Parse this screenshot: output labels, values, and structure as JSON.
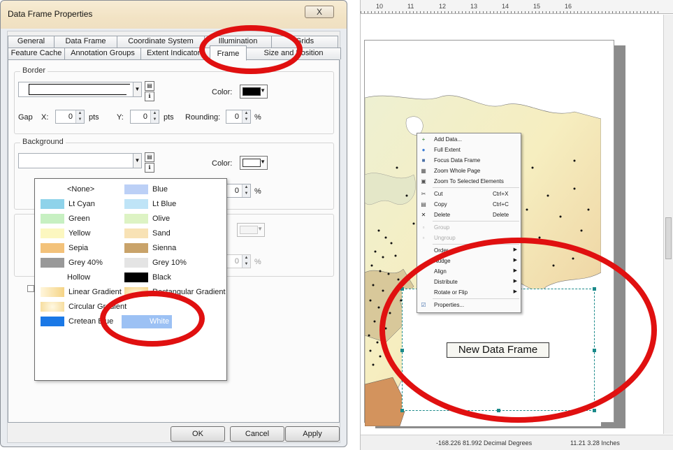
{
  "dialog": {
    "title": "Data Frame Properties",
    "close_glyph": "X",
    "tabs_row1": [
      "General",
      "Data Frame",
      "Coordinate System",
      "Illumination",
      "Grids"
    ],
    "tabs_row2": [
      "Feature Cache",
      "Annotation Groups",
      "Extent Indicators",
      "Frame",
      "Size and Position"
    ],
    "active_tab": "Frame",
    "border": {
      "group_label": "Border",
      "color_label": "Color:",
      "color": "#000000",
      "gap_label": "Gap",
      "x_label": "X:",
      "x_value": "0",
      "x_unit": "pts",
      "y_label": "Y:",
      "y_value": "0",
      "y_unit": "pts",
      "rounding_label": "Rounding:",
      "rounding_value": "0",
      "rounding_unit": "%"
    },
    "background": {
      "group_label": "Background",
      "color_label": "Color:",
      "color": "#ffffff",
      "partial_label": ":",
      "rounding_value": "0",
      "rounding_unit": "%"
    },
    "drop_shadow": {
      "partial_label_1": ":",
      "partial_label_2": ":",
      "rounding_value": "0",
      "rounding_unit": "%"
    },
    "buttons": {
      "ok": "OK",
      "cancel": "Cancel",
      "apply": "Apply"
    },
    "color_list": [
      {
        "label": "<None>",
        "color": "#ffffff",
        "col": 0,
        "row": 0,
        "none": true
      },
      {
        "label": "Blue",
        "color": "#bcd0f6",
        "col": 1,
        "row": 0
      },
      {
        "label": "Lt Cyan",
        "color": "#8fd3ea",
        "col": 0,
        "row": 1
      },
      {
        "label": "Lt Blue",
        "color": "#bfe4f7",
        "col": 1,
        "row": 1
      },
      {
        "label": "Green",
        "color": "#c7f0c2",
        "col": 0,
        "row": 2
      },
      {
        "label": "Olive",
        "color": "#ddf3c4",
        "col": 1,
        "row": 2
      },
      {
        "label": "Yellow",
        "color": "#fcf7c0",
        "col": 0,
        "row": 3
      },
      {
        "label": "Sand",
        "color": "#f8e2b5",
        "col": 1,
        "row": 3
      },
      {
        "label": "Sepia",
        "color": "#f3c27a",
        "col": 0,
        "row": 4
      },
      {
        "label": "Sienna",
        "color": "#c9a36a",
        "col": 1,
        "row": 4
      },
      {
        "label": "Grey 40%",
        "color": "#999999",
        "col": 0,
        "row": 5
      },
      {
        "label": "Grey 10%",
        "color": "#e4e4e4",
        "col": 1,
        "row": 5
      },
      {
        "label": "Hollow",
        "color": "#ffffff",
        "col": 0,
        "row": 6,
        "none": true
      },
      {
        "label": "Black",
        "color": "#000000",
        "col": 1,
        "row": 6
      },
      {
        "label": "Linear Gradient",
        "color": "#f5d486",
        "col": 0,
        "row": 7
      },
      {
        "label": "Rectangular Gradient",
        "color": "#f3d184",
        "col": 1,
        "row": 7
      },
      {
        "label": "Circular Gradient",
        "color": "#f6dc9c",
        "col": 0,
        "row": 8
      },
      {
        "label": "Cretean Blue",
        "color": "#1a78e6",
        "col": 0,
        "row": 9
      },
      {
        "label": "White",
        "color": "#9cc1f4",
        "col": 1,
        "row": 9,
        "selected": true
      }
    ]
  },
  "map_view": {
    "ruler_labels": [
      "10",
      "11",
      "12",
      "13",
      "14",
      "15",
      "16"
    ],
    "new_data_frame_label": "New Data Frame",
    "status_coords": "-168.226  81.992 Decimal Degrees",
    "status_size": "11.21  3.28 Inches",
    "context_menu": [
      {
        "icon": "+",
        "label": "Add Data...",
        "color": "#2a7d2a"
      },
      {
        "icon": "●",
        "label": "Full Extent",
        "color": "#3a7bd5"
      },
      {
        "icon": "■",
        "label": "Focus Data Frame",
        "color": "#4a6fa5"
      },
      {
        "icon": "▦",
        "label": "Zoom Whole Page",
        "color": "#555555"
      },
      {
        "icon": "▣",
        "label": "Zoom To Selected Elements",
        "color": "#555555"
      },
      {
        "icon": "✂",
        "label": "Cut",
        "shortcut": "Ctrl+X",
        "color": "#444444"
      },
      {
        "icon": "▤",
        "label": "Copy",
        "shortcut": "Ctrl+C",
        "color": "#444444"
      },
      {
        "icon": "✕",
        "label": "Delete",
        "shortcut": "Delete",
        "color": "#222222"
      },
      {
        "icon": "▫",
        "label": "Group",
        "disabled": true,
        "color": "#aaaaaa"
      },
      {
        "icon": "▫",
        "label": "Ungroup",
        "disabled": true,
        "color": "#aaaaaa"
      },
      {
        "label": "Order",
        "submenu": true
      },
      {
        "label": "Nudge",
        "submenu": true
      },
      {
        "label": "Align",
        "submenu": true
      },
      {
        "label": "Distribute",
        "submenu": true
      },
      {
        "label": "Rotate or Flip",
        "submenu": true
      },
      {
        "icon": "☑",
        "label": "Properties...",
        "color": "#3a6aa8"
      }
    ]
  },
  "annotations": {
    "highlight_color": "#e01010"
  }
}
